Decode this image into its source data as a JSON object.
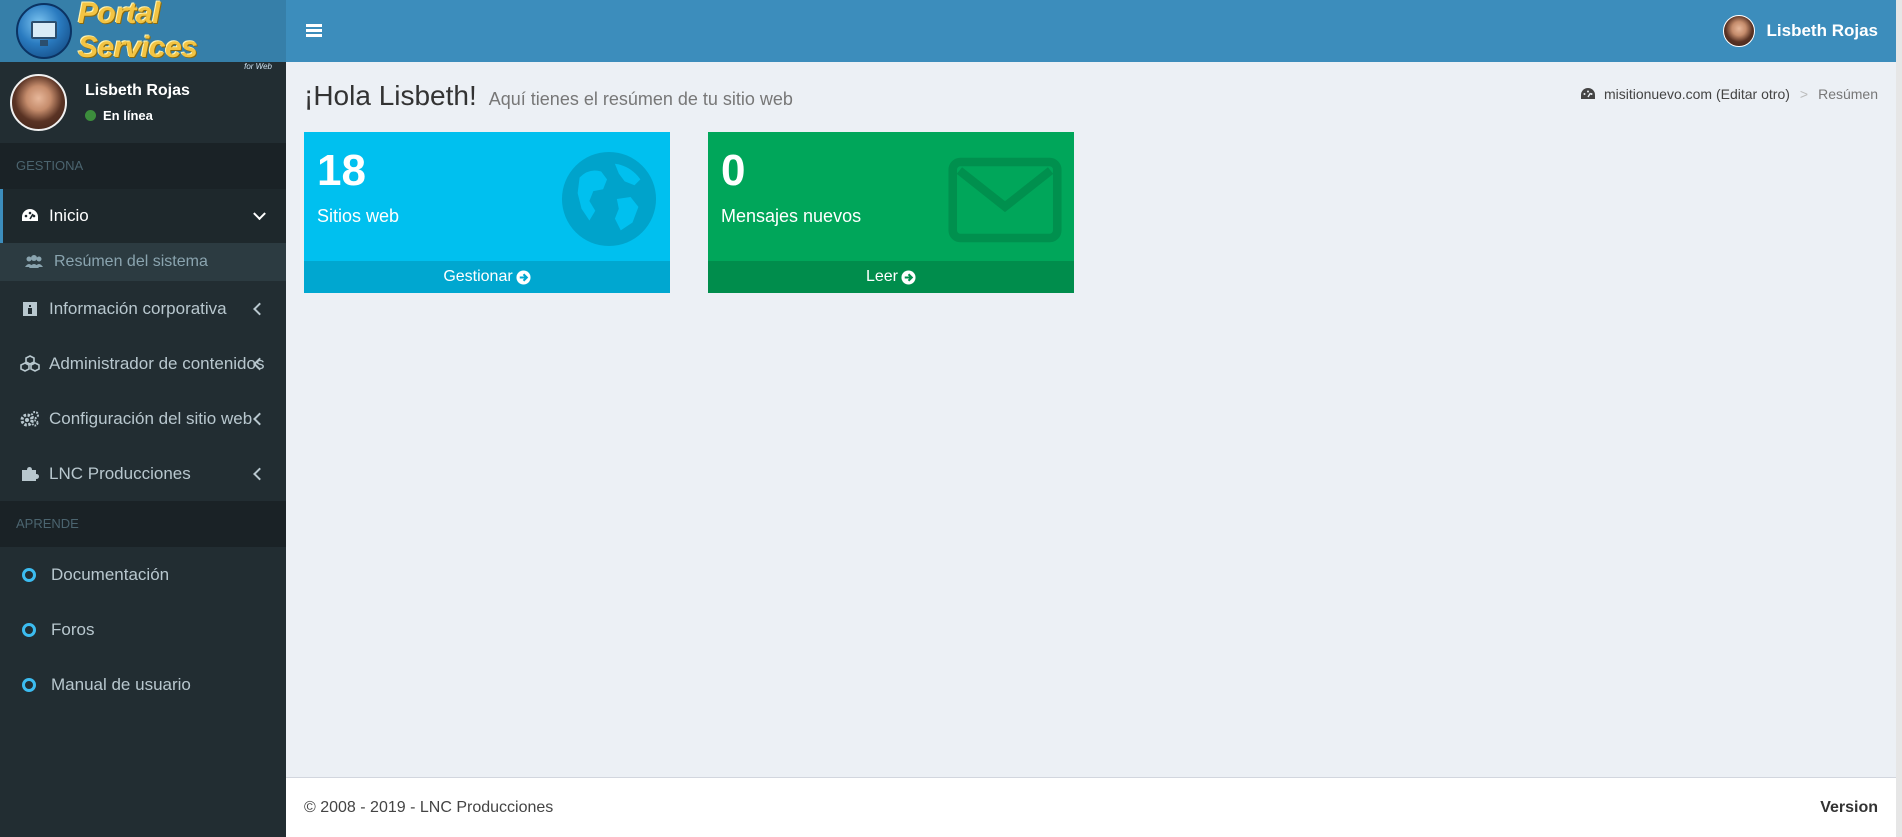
{
  "app": {
    "logo_title": "Portal Services",
    "logo_sub": "for Web"
  },
  "user": {
    "name": "Lisbeth Rojas",
    "status": "En línea"
  },
  "sidebar": {
    "sections": [
      {
        "header": "GESTIONA",
        "items": [
          {
            "label": "Inicio",
            "icon": "dashboard-icon",
            "active": true,
            "expanded": true
          },
          {
            "label": "Información corporativa",
            "icon": "id-card-icon"
          },
          {
            "label": "Administrador de contenidos",
            "icon": "cubes-icon"
          },
          {
            "label": "Configuración del sitio web",
            "icon": "gears-icon"
          },
          {
            "label": "LNC Producciones",
            "icon": "puzzle-icon"
          }
        ],
        "submenu": [
          {
            "label": "Resúmen del sistema",
            "icon": "users-icon"
          }
        ]
      },
      {
        "header": "APRENDE",
        "items": [
          {
            "label": "Documentación",
            "icon": "circle-icon"
          },
          {
            "label": "Foros",
            "icon": "circle-icon"
          },
          {
            "label": "Manual de usuario",
            "icon": "circle-icon"
          }
        ]
      }
    ]
  },
  "content": {
    "title": "¡Hola Lisbeth!",
    "subtitle": "Aquí tienes el resúmen de tu sitio web",
    "breadcrumb": {
      "site": "misitionuevo.com (Editar otro)",
      "separator": ">",
      "current": "Resúmen"
    }
  },
  "boxes": [
    {
      "number": "18",
      "text": "Sitios web",
      "footer": "Gestionar",
      "color": "#00c0ef",
      "icon": "globe-icon"
    },
    {
      "number": "0",
      "text": "Mensajes nuevos",
      "footer": "Leer",
      "color": "#00a65a",
      "icon": "envelope-icon"
    }
  ],
  "footer": {
    "copyright": "© 2008 - 2019 - LNC Producciones",
    "version": "Version"
  },
  "colors": {
    "header": "#3c8dbc",
    "sidebar": "#222d32",
    "accent": "#3cbcf0"
  }
}
